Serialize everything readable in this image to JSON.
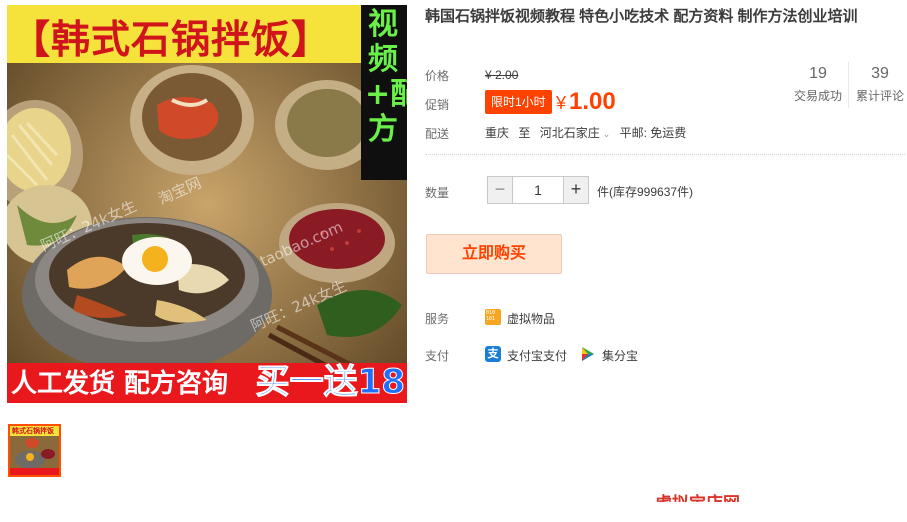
{
  "product": {
    "title": "韩国石锅拌饭视频教程 特色小吃技术 配方资料 制作方法创业培训",
    "image": {
      "banner_top": "【韩式石锅拌饭】",
      "side_text": "视频+配方",
      "banner_bottom_left": "人工发货 配方咨询",
      "banner_bottom_right": "买一送18",
      "watermarks": [
        "阿旺：24k女生",
        "淘宝网",
        "阿旺：24k女生",
        "taobao.com"
      ],
      "thumb_band": "韩式石锅拌饭"
    }
  },
  "price": {
    "label": "价格",
    "original": "¥ 2.00"
  },
  "promo": {
    "label": "促销",
    "badge": "限时1小时",
    "currency": "¥",
    "value": "1.00"
  },
  "delivery": {
    "label": "配送",
    "from": "重庆",
    "to_word": "至",
    "destination": "河北石家庄",
    "shipping": "平邮: 免运费"
  },
  "stats": {
    "sales_count": "19",
    "sales_label": "交易成功",
    "reviews_count": "39",
    "reviews_label": "累计评论"
  },
  "quantity": {
    "label": "数量",
    "minus": "−",
    "value": "1",
    "plus": "+",
    "stock": "件(库存999637件)"
  },
  "buy_button": "立即购买",
  "service": {
    "label": "服务",
    "icon": "virtual-goods-icon",
    "item": "虚拟物品"
  },
  "payment": {
    "label": "支付",
    "alipay_icon": "alipay-icon",
    "alipay": "支付宝支付",
    "jifenbao_icon": "jifenbao-icon",
    "jifenbao": "集分宝"
  },
  "footer_cut_text": "虚拟宝店网",
  "colors": {
    "accent": "#ff4200",
    "buy_bg": "#ffe4d0",
    "banner_yellow": "#f5e23a",
    "banner_red": "#e9181c",
    "side_green": "#6bf04a"
  }
}
